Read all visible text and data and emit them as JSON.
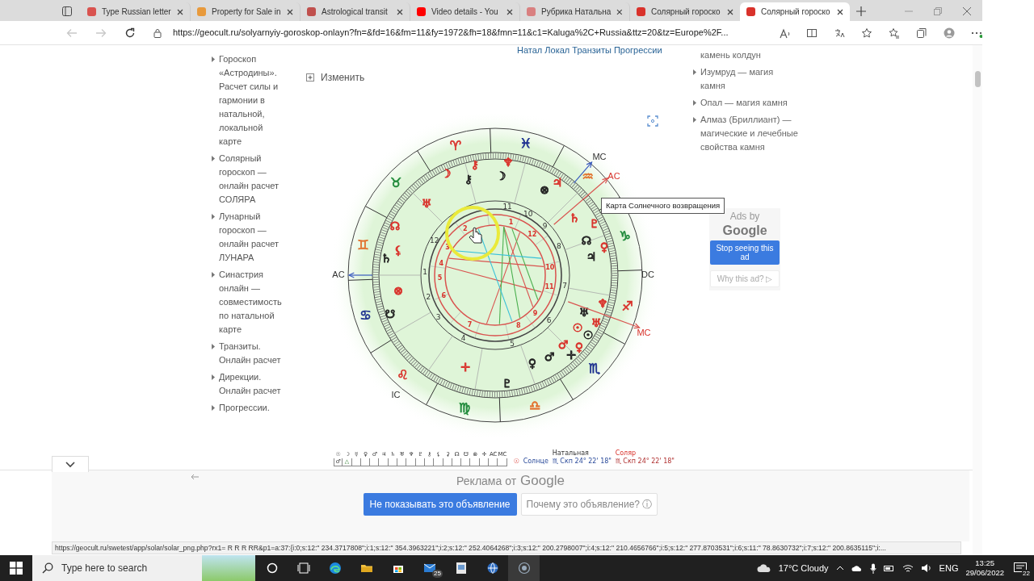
{
  "browser": {
    "tabs": [
      {
        "title": "Type Russian letter",
        "color": "#d9534f",
        "selected": false
      },
      {
        "title": "Property for Sale in",
        "color": "#e89a3c",
        "selected": false
      },
      {
        "title": "Astrological transit",
        "color": "#c0504d",
        "selected": false
      },
      {
        "title": "Video details - You",
        "color": "#ff0000",
        "selected": false
      },
      {
        "title": "Рубрика Натальна",
        "color": "#d98080",
        "selected": false
      },
      {
        "title": "Солярный гороско",
        "color": "#d9322b",
        "selected": false
      },
      {
        "title": "Солярный гороско",
        "color": "#d9322b",
        "selected": true
      }
    ],
    "nav": [
      {
        "kind": "back",
        "disabled": true
      },
      {
        "kind": "forward",
        "disabled": true
      },
      {
        "kind": "refresh",
        "disabled": false
      }
    ],
    "url": "https://geocult.ru/solyarnyiy-goroskop-onlayn?fn=&fd=16&fm=11&fy=1972&fh=18&fmn=11&c1=Kaluga%2C+Russia&ttz=20&tz=Europe%2F..."
  },
  "page": {
    "top_links": "Натал Локал Транзиты Прогрессии",
    "left_menu": [
      "Гороскоп «Астродины». Расчет силы и гармонии в натальной, локальной карте",
      "Солярный гороскоп — онлайн расчет СОЛЯРА",
      "Лунарный гороскоп — онлайн расчет ЛУНАРА",
      "Синастрия онлайн — совместимость по натальной карте",
      "Транзиты. Онлайн расчет",
      "Дирекции. Онлайн расчет",
      "Прогрессии."
    ],
    "edit_label": "Изменить",
    "chart": {
      "signs": [
        {
          "glyph": "♈",
          "color": "#d9322b"
        },
        {
          "glyph": "♉",
          "color": "#1f8a3a"
        },
        {
          "glyph": "♊",
          "color": "#e2702b"
        },
        {
          "glyph": "♋",
          "color": "#1c2f8f"
        },
        {
          "glyph": "♌",
          "color": "#d9322b"
        },
        {
          "glyph": "♍",
          "color": "#1f8a3a"
        },
        {
          "glyph": "♎",
          "color": "#e2702b"
        },
        {
          "glyph": "♏",
          "color": "#1c2f8f"
        },
        {
          "glyph": "♐",
          "color": "#d9322b"
        },
        {
          "glyph": "♑",
          "color": "#1f8a3a"
        },
        {
          "glyph": "♒",
          "color": "#e2702b"
        },
        {
          "glyph": "♓",
          "color": "#1c2f8f"
        }
      ],
      "outer_houses": [
        "1",
        "2",
        "3",
        "4",
        "5",
        "6",
        "7",
        "8",
        "9",
        "10",
        "11",
        "12"
      ],
      "inner_houses": [
        "1",
        "2",
        "3",
        "4",
        "5",
        "6",
        "7",
        "8",
        "9",
        "10",
        "11",
        "12"
      ],
      "planets": [
        {
          "glyph": "☽",
          "color": "#d9322b"
        },
        {
          "glyph": "⚷",
          "color": "#222222"
        },
        {
          "glyph": "⚷",
          "color": "#d9322b"
        },
        {
          "glyph": "☽",
          "color": "#222222"
        },
        {
          "glyph": "♆",
          "color": "#d9322b"
        },
        {
          "glyph": "♅",
          "color": "#d9322b"
        },
        {
          "glyph": "☊",
          "color": "#d9322b"
        },
        {
          "glyph": "⚸",
          "color": "#d9322b"
        },
        {
          "glyph": "♄",
          "color": "#222222"
        },
        {
          "glyph": "⊗",
          "color": "#d9322b"
        },
        {
          "glyph": "☋",
          "color": "#222222"
        },
        {
          "glyph": "⊗",
          "color": "#222222"
        },
        {
          "glyph": "♃",
          "color": "#d9322b"
        },
        {
          "glyph": "♄",
          "color": "#d9322b"
        },
        {
          "glyph": "♇",
          "color": "#d9322b"
        },
        {
          "glyph": "☊",
          "color": "#222222"
        },
        {
          "glyph": "♀",
          "color": "#d9322b"
        },
        {
          "glyph": "♃",
          "color": "#222222"
        },
        {
          "glyph": "♆",
          "color": "#d9322b"
        },
        {
          "glyph": "♅",
          "color": "#222222"
        },
        {
          "glyph": "♅",
          "color": "#d9322b"
        },
        {
          "glyph": "☉",
          "color": "#d9322b"
        },
        {
          "glyph": "☉",
          "color": "#222222"
        },
        {
          "glyph": "♀",
          "color": "#d9322b"
        },
        {
          "glyph": "♂",
          "color": "#d9322b"
        },
        {
          "glyph": "✛",
          "color": "#222222"
        },
        {
          "glyph": "♂",
          "color": "#222222"
        },
        {
          "glyph": "♀",
          "color": "#222222"
        },
        {
          "glyph": "♇",
          "color": "#222222"
        },
        {
          "glyph": "✛",
          "color": "#d9322b"
        }
      ],
      "angles": [
        {
          "text": "AC",
          "kind": "natal"
        },
        {
          "text": "MC",
          "kind": "natal"
        },
        {
          "text": "AC",
          "kind": "solar"
        },
        {
          "text": "DC",
          "kind": "natal"
        },
        {
          "text": "MC",
          "kind": "solar"
        },
        {
          "text": "IC",
          "kind": "natal"
        }
      ]
    },
    "tooltip": "Карта Солнечного возвращения",
    "aspect_table": {
      "headers": [
        "☉",
        "☽",
        "☿",
        "♀",
        "♂",
        "♃",
        "♄",
        "♅",
        "♆",
        "♇",
        "⚷",
        "⚸",
        "⚳",
        "☊",
        "☋",
        "⊗",
        "✛",
        "AC",
        "MC"
      ],
      "row": [
        "♂",
        "△"
      ]
    },
    "positions_table": {
      "natal_header": "Натальная",
      "solar_header": "Соляр",
      "planet_icon": "☉",
      "planet": "Солнце",
      "natal": "♏ Скп 24° 22' 18\"",
      "solar": "♏ Скп 24° 22' 18\""
    },
    "right_menu": {
      "cut_line": "камень колдун",
      "items": [
        "Изумруд — магия камня",
        "Опал — магия камня",
        "Алмаз (Бриллиант) — магические и лечебные свойства камня"
      ]
    },
    "side_ad": {
      "line1": "Ads by",
      "line2": "Google",
      "stop_button": "Stop seeing this ad",
      "why_button": "Why this ad? ▷"
    }
  },
  "bottom_ad": {
    "title_prefix": "Реклама от",
    "title_brand": "Google",
    "hide_button": "Не показывать это объявление",
    "why_button": "Почему это объявление? ⓘ"
  },
  "status_url": "https://geocult.ru/swetest/app/solar/solar_png.php?rx1=  R  R  R  RR&p1=a:37:{i:0;s:12:\" 234.3717808\";i:1;s:12:\" 354.3963221\";i:2;s:12:\" 252.4064268\";i:3;s:12:\" 200.2798007\";i:4;s:12:\" 210.4656766\";i:5;s:12:\" 277.8703531\";i:6;s:11:\" 78.8630732\";i:7;s:12:\" 200.8635115\";i:...",
  "taskbar": {
    "search_label": "Type here to search",
    "apps": [
      {
        "kind": "cortana",
        "selected": false
      },
      {
        "kind": "taskview",
        "selected": false
      },
      {
        "kind": "edge",
        "selected": false
      },
      {
        "kind": "explorer",
        "selected": false
      },
      {
        "kind": "store",
        "selected": false
      },
      {
        "kind": "mail",
        "selected": false,
        "badge": "25"
      },
      {
        "kind": "viewer",
        "selected": false
      },
      {
        "kind": "globe",
        "selected": false
      },
      {
        "kind": "recorder",
        "selected": true
      }
    ],
    "weather": "17°C Cloudy",
    "language": "ENG",
    "time": "13:25",
    "date": "29/06/2022",
    "notifications": "22"
  }
}
